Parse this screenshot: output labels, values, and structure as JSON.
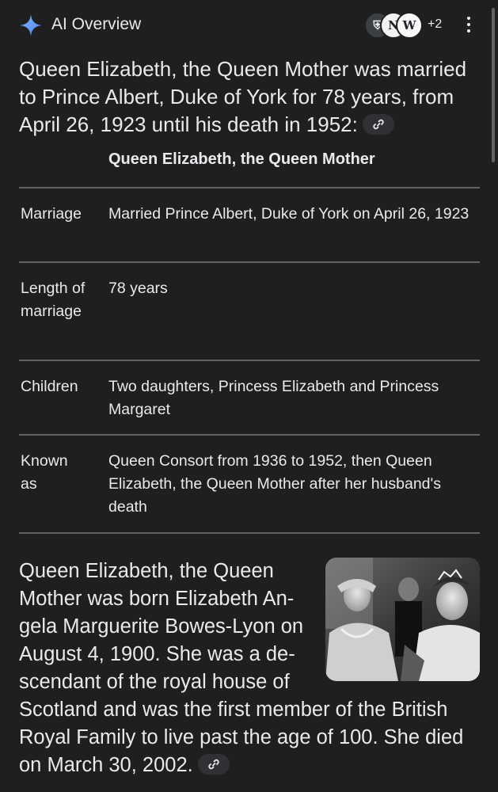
{
  "header": {
    "title": "AI Overview",
    "sources": [
      {
        "glyph": "⛨",
        "icon": "crest-icon"
      },
      {
        "glyph": "N",
        "icon": "source-n-icon"
      },
      {
        "glyph": "W",
        "icon": "wikipedia-icon"
      }
    ],
    "more_count": "+2"
  },
  "summary": {
    "text": "Queen Elizabeth, the Queen Mother was married to Prince Albert, Duke of York for 78 years, from April 26, 1923 until his death in 1952:"
  },
  "table": {
    "title": "Queen Elizabeth, the Queen Mother",
    "rows": [
      {
        "label": "Marriage",
        "value": "Married Prince Albert, Duke of York on April 26, 1923"
      },
      {
        "label": "Length of marriage",
        "value": "78 years"
      },
      {
        "label": "Children",
        "value": "Two daughters, Princess Elizabeth and Princess Margaret"
      },
      {
        "label": "Known as",
        "value": "Queen Consort from 1936 to 1952, then Queen Elizabeth, the Queen Mother after her husband's death"
      }
    ]
  },
  "bio": {
    "lines": [
      "Queen Elizabeth, the Queen",
      "Mother was born Elizabeth An-",
      "gela Marguerite Bowes-Lyon on",
      "August 4, 1900. She was a de-",
      "scendant of the royal house of",
      "Scotland and was the first member of the British",
      "Royal Family to live past the age of 100. She died",
      "on March 30, 2002."
    ]
  },
  "colors": {
    "background": "#1f1f1f",
    "text": "#e8eaed",
    "divider": "#5f6368",
    "chip": "#303134",
    "star_blue": "#4285f4"
  }
}
